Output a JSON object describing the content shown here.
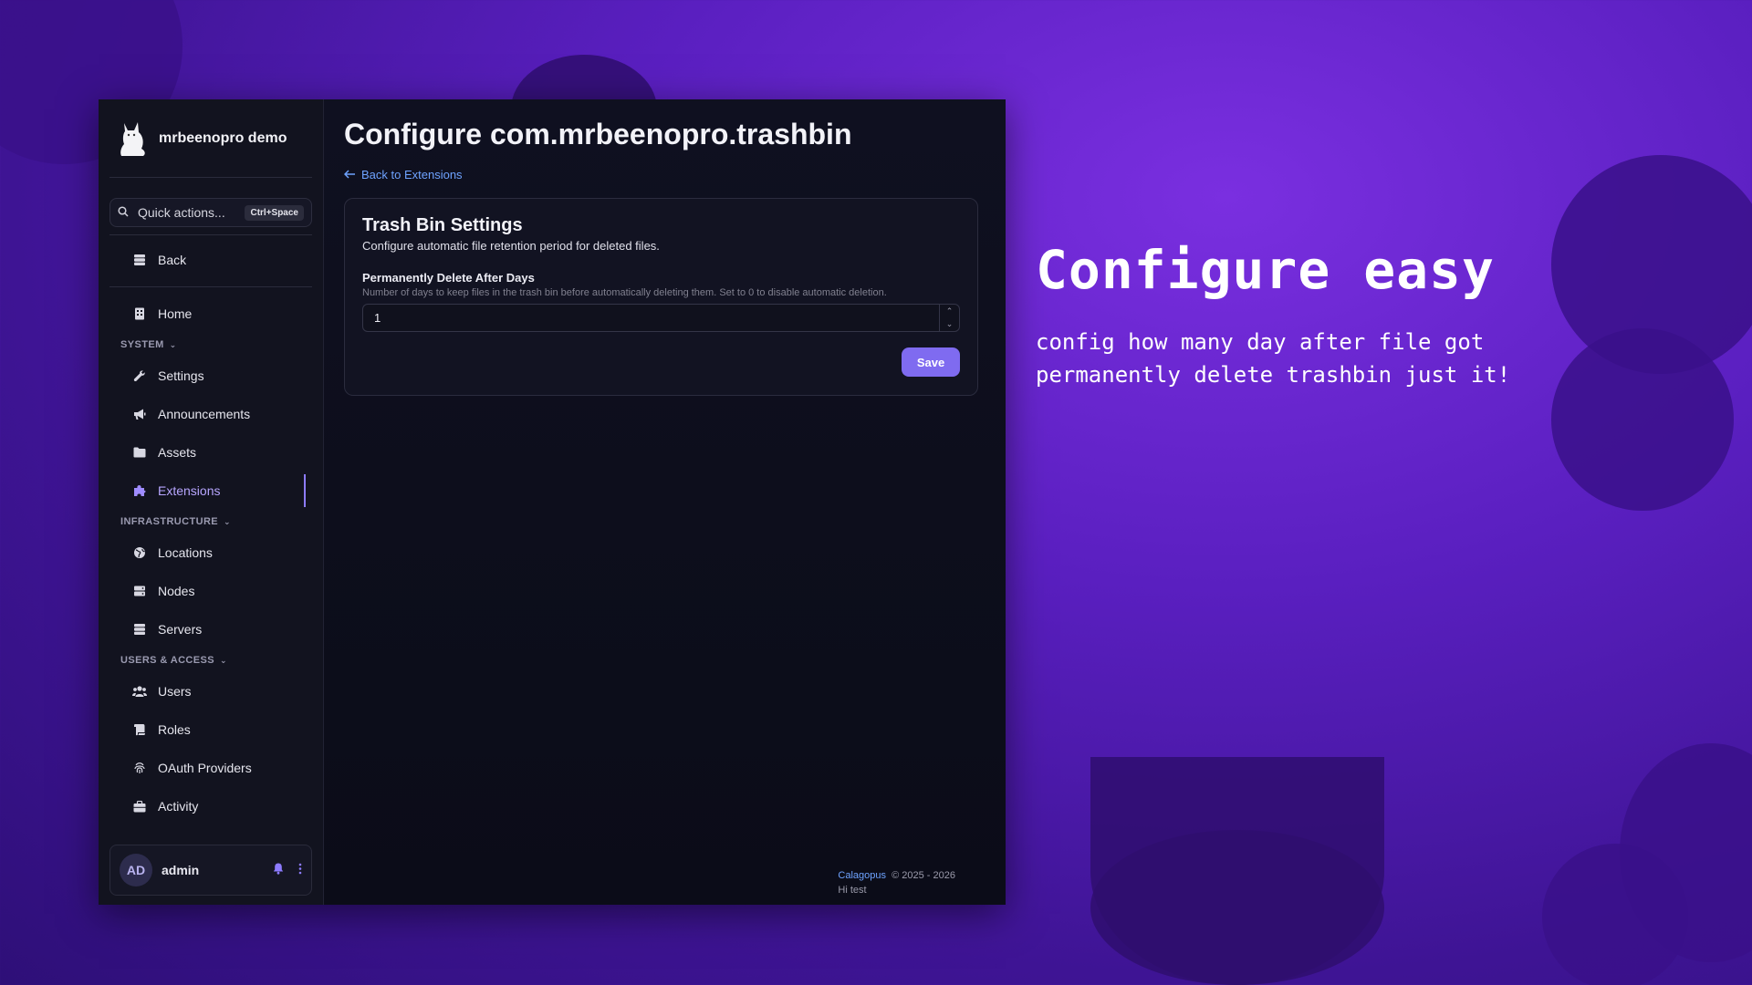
{
  "promo": {
    "title": "Configure easy",
    "subtitle": "config how many day after file got permanently delete trashbin just it!"
  },
  "sidebar": {
    "brand_name": "mrbeenopro demo",
    "search_placeholder": "Quick actions...",
    "search_shortcut": "Ctrl+Space",
    "back_label": "Back",
    "home_label": "Home",
    "sections": {
      "system": "SYSTEM",
      "infrastructure": "INFRASTRUCTURE",
      "users_access": "USERS & ACCESS"
    },
    "system_items": [
      "Settings",
      "Announcements",
      "Assets",
      "Extensions"
    ],
    "infrastructure_items": [
      "Locations",
      "Nodes",
      "Servers"
    ],
    "users_items": [
      "Users",
      "Roles",
      "OAuth Providers",
      "Activity"
    ],
    "active_item": "Extensions",
    "user": {
      "initials": "AD",
      "name": "admin"
    }
  },
  "main": {
    "page_title": "Configure com.mrbeenopro.trashbin",
    "back_link": "Back to Extensions",
    "card": {
      "title": "Trash Bin Settings",
      "description": "Configure automatic file retention period for deleted files.",
      "field_label": "Permanently Delete After Days",
      "field_help": "Number of days to keep files in the trash bin before automatically deleting them. Set to 0 to disable automatic deletion.",
      "field_value": "1",
      "save_label": "Save"
    },
    "footer": {
      "brand": "Calagopus",
      "copyright": "© 2025 - 2026",
      "note": "Hi test"
    }
  },
  "colors": {
    "accent": "#7f6bf0",
    "link": "#6ea3ff",
    "background": "#5a1fc0"
  }
}
